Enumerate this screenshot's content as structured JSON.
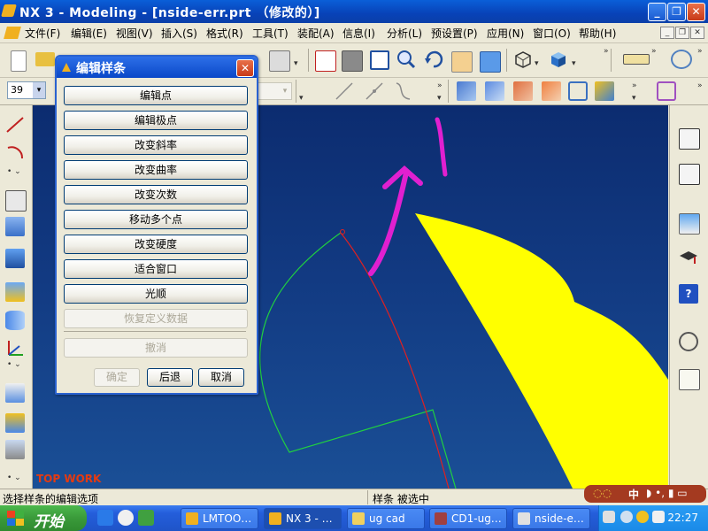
{
  "window": {
    "title": "NX 3 - Modeling - [nside-err.prt （修改的）]"
  },
  "menu": [
    "文件(F)",
    "编辑(E)",
    "视图(V)",
    "插入(S)",
    "格式(R)",
    "工具(T)",
    "装配(A)",
    "信息(I)",
    "分析(L)",
    "预设置(P)",
    "应用(N)",
    "窗口(O)",
    "帮助(H)"
  ],
  "toolbar": {
    "layer_value": "39"
  },
  "dialog": {
    "title": "编辑样条",
    "buttons": [
      "编辑点",
      "编辑极点",
      "改变斜率",
      "改变曲率",
      "改变次数",
      "移动多个点",
      "改变硬度",
      "适合窗口",
      "光顺"
    ],
    "disabled_buttons": [
      "恢复定义数据",
      "撤消"
    ],
    "ok": "确定",
    "back": "后退",
    "cancel": "取消"
  },
  "canvas": {
    "watermark": "TOP WORK"
  },
  "status": {
    "left": "选择样条的编辑选项",
    "right": "样条 被选中"
  },
  "ime": {
    "label": "中"
  },
  "taskbar": {
    "start": "开始",
    "tasks": [
      "LMTOO…",
      "NX 3 - …",
      "ug cad",
      "CD1-ug…",
      "nside-e…"
    ],
    "clock": "22:27"
  },
  "colors": {
    "accent": "#0a48c8",
    "canvas": "#123a82",
    "surface": "#ffff00",
    "annotation": "#e020d0"
  }
}
